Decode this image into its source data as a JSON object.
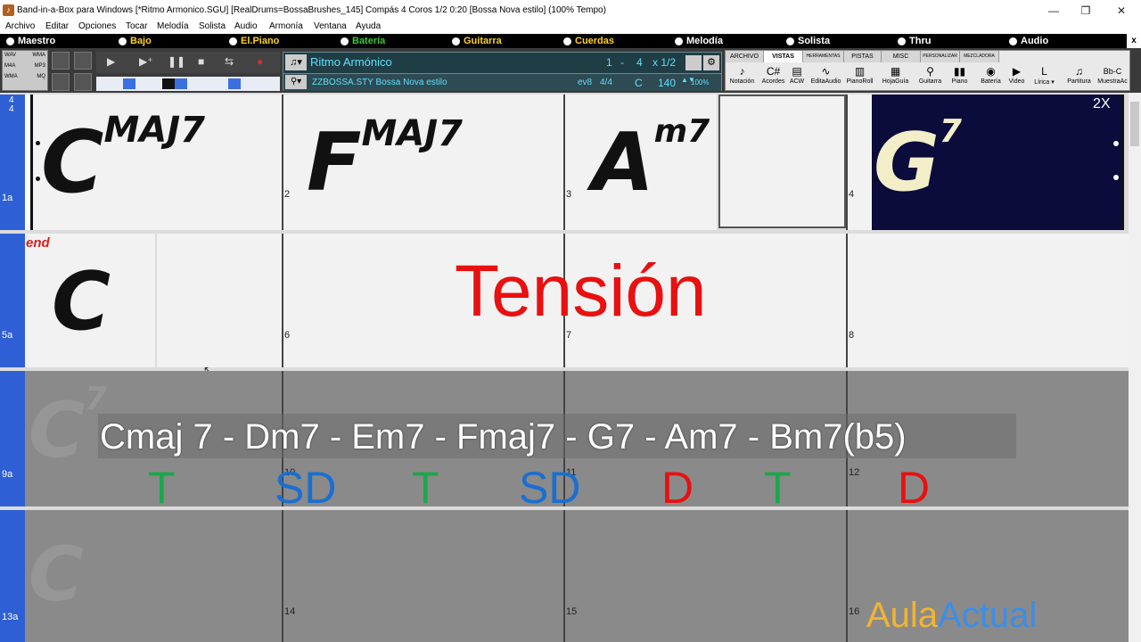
{
  "window": {
    "title": "Band-in-a-Box para Windows  [*Ritmo Armonico.SGU] [RealDrums=BossaBrushes_145] Compás 4 Coros 1/2   0:20  [Bossa Nova estilo] (100% Tempo)",
    "minimize": "—",
    "maximize": "❐",
    "close": "✕"
  },
  "menu": [
    "Archivo",
    "Editar",
    "Opciones",
    "Tocar",
    "Melodía",
    "Solista",
    "Audio",
    "Armonía",
    "Ventana",
    "Ayuda"
  ],
  "tracks": [
    {
      "label": "Maestro",
      "color": "#ffffff"
    },
    {
      "label": "Bajo",
      "color": "#ffd21f"
    },
    {
      "label": "El.Piano",
      "color": "#ffd21f"
    },
    {
      "label": "Batería",
      "color": "#3ac83a"
    },
    {
      "label": "Guitarra",
      "color": "#ffd21f"
    },
    {
      "label": "Cuerdas",
      "color": "#ffd21f"
    },
    {
      "label": "Melodía",
      "color": "#ffffff"
    },
    {
      "label": "Solista",
      "color": "#ffffff"
    },
    {
      "label": "Thru",
      "color": "#ffffff"
    },
    {
      "label": "Audio",
      "color": "#ffffff"
    }
  ],
  "trackbar_close": "x",
  "toolbar": {
    "file_labels": [
      "WAV",
      "WMA",
      "M4A",
      "MP3",
      "WMA",
      "MQ"
    ],
    "song_title": "Ritmo Armónico",
    "measure_from": "1",
    "measure_to": "4",
    "choruses": "x 1/2",
    "style_file": "ZZBOSSA.STY Bossa Nova estilo",
    "ev8": "ev8",
    "time_sig": "4/4",
    "key": "C",
    "tempo": "140",
    "tempo_pct": "100%"
  },
  "views": {
    "tabs": [
      "ARCHIVO",
      "VISTAS",
      "HERRAMENTAS",
      "PISTAS",
      "MISC",
      "PERSONALIZAR",
      "MEZCLADORA"
    ],
    "buttons": [
      {
        "label": "Notación",
        "icon": "♪"
      },
      {
        "label": "Acordes",
        "icon": "C#"
      },
      {
        "label": "ACW",
        "icon": "▤"
      },
      {
        "label": "EditaAudio",
        "icon": "∿"
      },
      {
        "label": "PianoRoll",
        "icon": "▥"
      },
      {
        "label": "HojaGuía",
        "icon": "▦"
      },
      {
        "label": "Guitarra",
        "icon": "⚲"
      },
      {
        "label": "Piano",
        "icon": "▮▮"
      },
      {
        "label": "Batería",
        "icon": "◉"
      },
      {
        "label": "Video",
        "icon": "▶"
      },
      {
        "label": "Lírica ▾",
        "icon": "L"
      },
      {
        "label": "Partitura",
        "icon": "♫"
      },
      {
        "label": "MuestraAc",
        "icon": "Bb-C"
      }
    ]
  },
  "sheet": {
    "time_sig_top": "4",
    "time_sig_bottom": "4",
    "rows": [
      "1a",
      "5a",
      "9a",
      "13a"
    ],
    "bars": {
      "b2": "2",
      "b3": "3",
      "b4": "4",
      "b6": "6",
      "b7": "7",
      "b8": "8",
      "b10": "10",
      "b11": "11",
      "b12": "12",
      "b14": "14",
      "b15": "15",
      "b16": "16"
    },
    "chords": {
      "c1_root": "C",
      "c1_ext": "MAJ7",
      "c2_root": "F",
      "c2_ext": "MAJ7",
      "c3_root": "A",
      "c3_ext": "m7",
      "c4_root": "G",
      "c4_ext": "7",
      "c5_root": "C",
      "c9_root": "C",
      "c9_ext": "7",
      "c13_root": "C"
    },
    "repeat": "2X",
    "end_marker": "end"
  },
  "overlay": {
    "tension": "Tensión",
    "progression": "Cmaj 7 - Dm7 - Em7 - Fmaj7 - G7 - Am7 - Bm7(b5)",
    "functions": [
      {
        "label": "T",
        "color": "#1aa84a"
      },
      {
        "label": "SD",
        "color": "#1a6fd0"
      },
      {
        "label": "T",
        "color": "#1aa84a"
      },
      {
        "label": "SD",
        "color": "#1a6fd0"
      },
      {
        "label": "D",
        "color": "#e81010"
      },
      {
        "label": "T",
        "color": "#1aa84a"
      },
      {
        "label": "D",
        "color": "#e81010"
      }
    ],
    "brand_part1": "Aula",
    "brand_part2": "Actual",
    "brand_colors": [
      "#f2b430",
      "#3a8ee8"
    ]
  }
}
